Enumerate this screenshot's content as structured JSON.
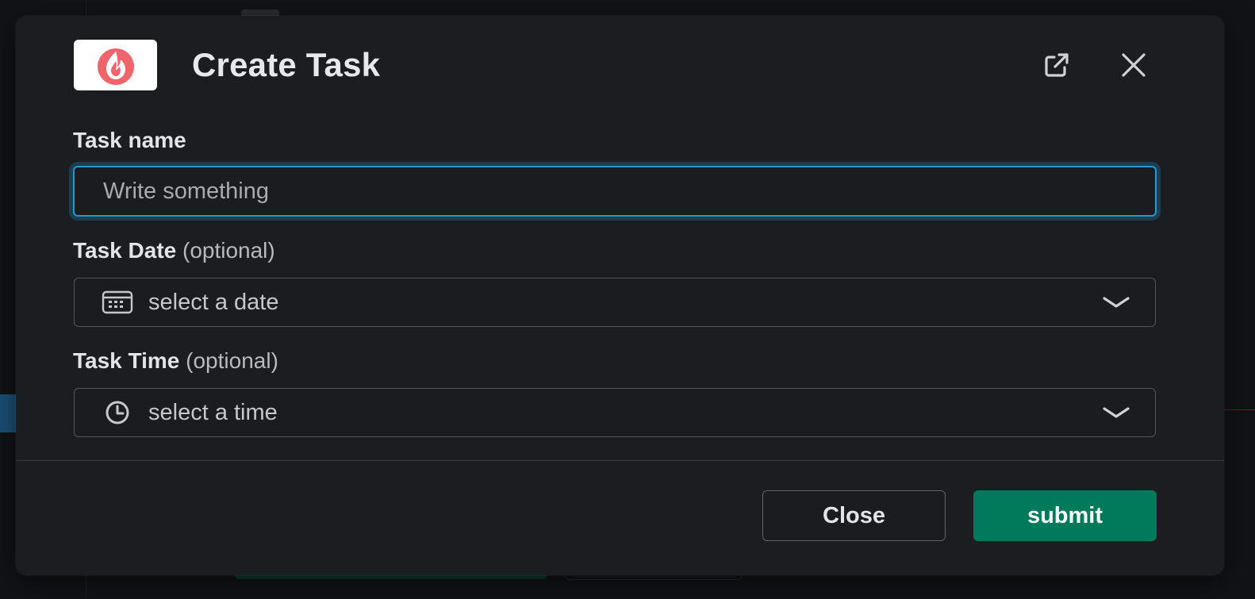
{
  "dialog": {
    "title": "Create Task",
    "logo_icon": "flame-icon",
    "logo_color": "#f0646b",
    "actions": {
      "popout_icon": "open-external-icon",
      "close_icon": "close-icon"
    }
  },
  "form": {
    "task_name": {
      "label": "Task name",
      "value": "",
      "placeholder": "Write something"
    },
    "task_date": {
      "label": "Task Date",
      "optional_note": "(optional)",
      "icon": "calendar-icon",
      "placeholder": "select a date"
    },
    "task_time": {
      "label": "Task Time",
      "optional_note": "(optional)",
      "icon": "clock-icon",
      "placeholder": "select a time"
    }
  },
  "footer": {
    "close_label": "Close",
    "submit_label": "submit",
    "submit_color": "#007a5a"
  },
  "colors": {
    "focus_ring": "#1d9bd1",
    "dialog_bg": "#1b1d21"
  }
}
